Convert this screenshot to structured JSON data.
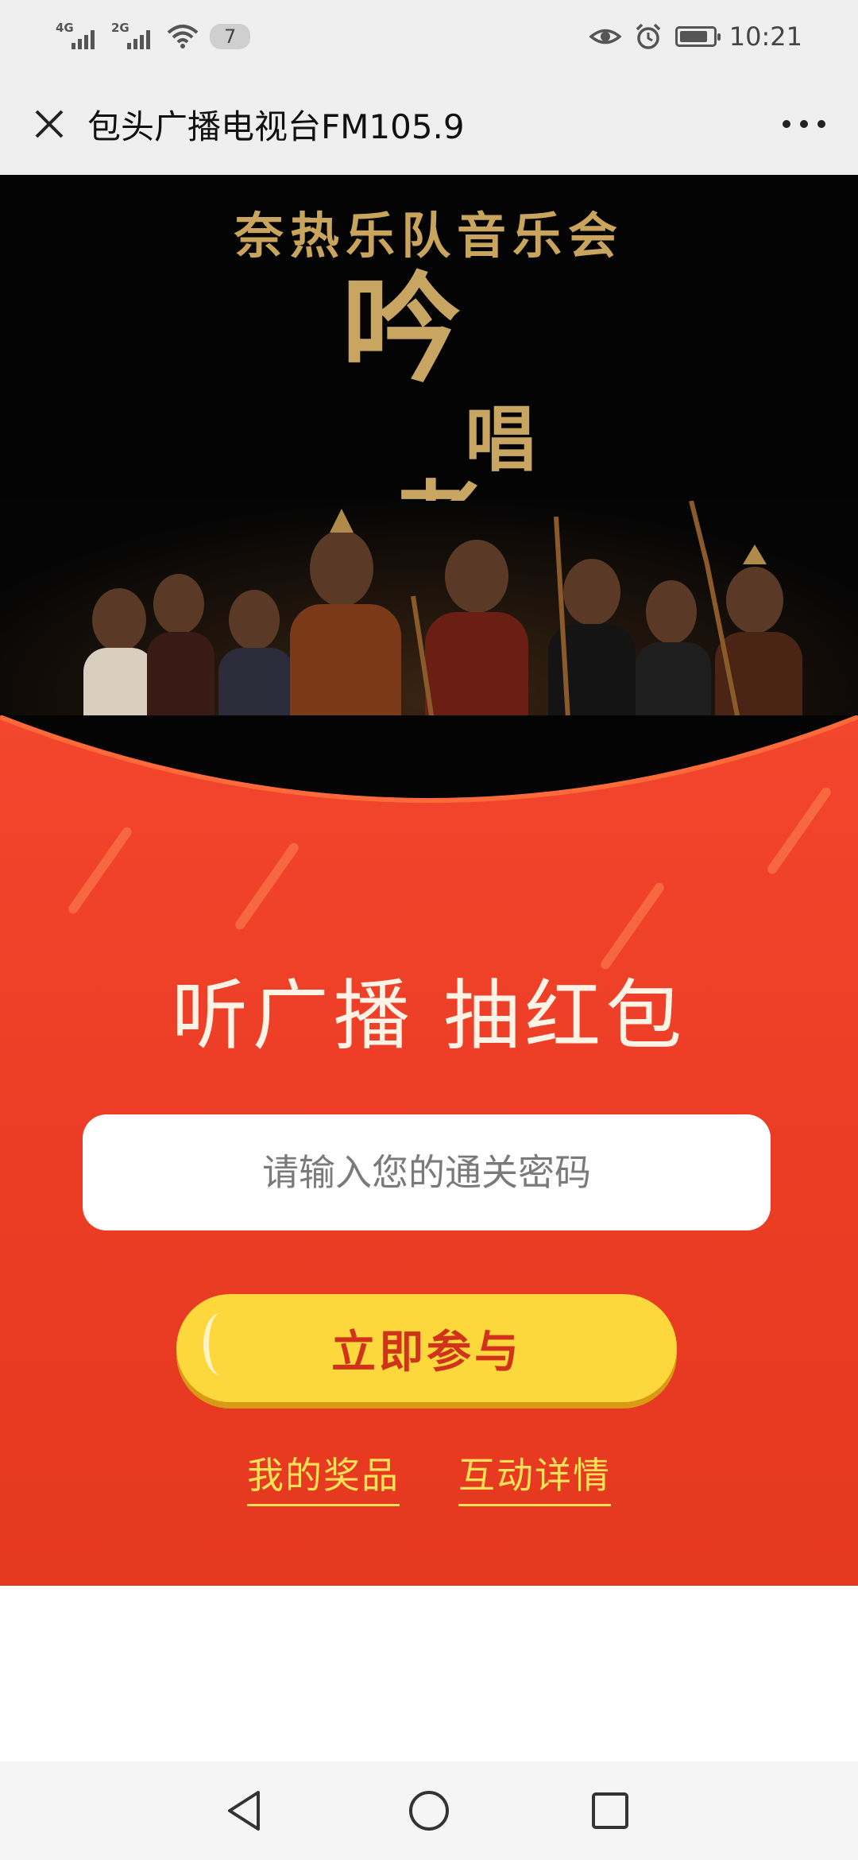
{
  "status_bar": {
    "network_1": "4G",
    "network_2": "2G",
    "notification_count": "7",
    "time": "10:21",
    "battery_level": 0.85
  },
  "title_bar": {
    "title": "包头广播电视台FM105.9"
  },
  "hero": {
    "subtitle": "奈热乐队音乐会",
    "title_char_1": "吟",
    "title_char_2": "唱",
    "title_char_3": "者"
  },
  "panel": {
    "headline": "听广播 抽红包",
    "code_placeholder": "请输入您的通关密码",
    "join_button": "立即参与",
    "link_prizes": "我的奖品",
    "link_details": "互动详情"
  },
  "colors": {
    "panel_red": "#ec3c25",
    "button_yellow": "#fcd83c",
    "button_text": "#d0331a",
    "link_yellow": "#fde05a",
    "gold": "#c8a560"
  },
  "icons": {
    "close": "close-icon",
    "more": "more-icon",
    "back": "back-triangle-icon",
    "home": "home-circle-icon",
    "recents": "recents-square-icon"
  }
}
